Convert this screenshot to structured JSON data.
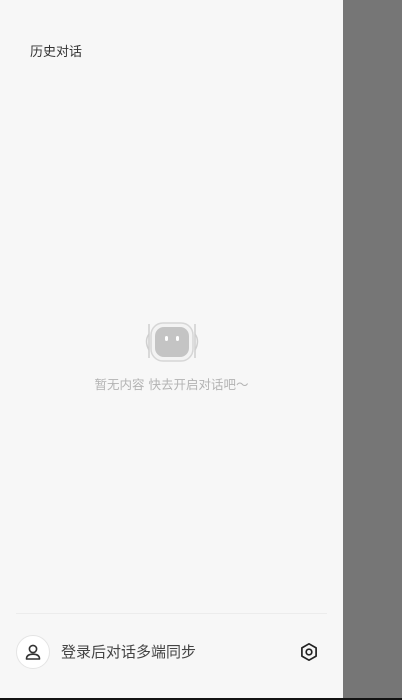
{
  "drawer": {
    "title": "历史对话",
    "background": "#f7f7f7"
  },
  "empty_state": {
    "icon": "robot-icon",
    "text": "暂无内容 快去开启对话吧～"
  },
  "footer": {
    "avatar_icon": "user-icon",
    "login_text": "登录后对话多端同步",
    "settings_icon": "settings-icon"
  },
  "overlay": {
    "color": "#767676"
  }
}
